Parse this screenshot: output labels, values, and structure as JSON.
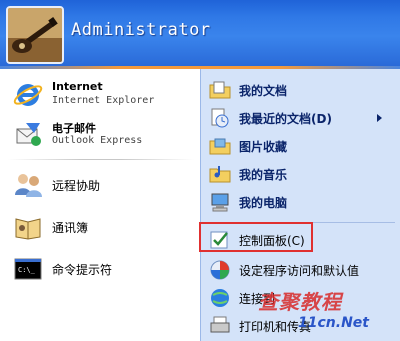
{
  "header": {
    "username": "Administrator"
  },
  "left": {
    "pinned": [
      {
        "title": "Internet",
        "subtitle": "Internet Explorer",
        "icon": "internet-explorer-icon"
      },
      {
        "title": "电子邮件",
        "subtitle": "Outlook Express",
        "icon": "outlook-express-icon"
      }
    ],
    "recent": [
      {
        "label": "远程协助",
        "icon": "remote-assistance-icon"
      },
      {
        "label": "通讯簿",
        "icon": "address-book-icon"
      },
      {
        "label": "命令提示符",
        "icon": "command-prompt-icon"
      }
    ]
  },
  "right": {
    "items": [
      {
        "label": "我的文档",
        "icon": "my-documents-icon"
      },
      {
        "label": "我最近的文档(D)",
        "icon": "recent-documents-icon",
        "submenu": true
      },
      {
        "label": "图片收藏",
        "icon": "my-pictures-icon"
      },
      {
        "label": "我的音乐",
        "icon": "my-music-icon"
      },
      {
        "label": "我的电脑",
        "icon": "my-computer-icon"
      }
    ],
    "system": [
      {
        "label": "控制面板(C)",
        "icon": "control-panel-icon",
        "highlighted": true
      },
      {
        "label": "设定程序访问和默认值",
        "icon": "program-access-icon"
      },
      {
        "label": "连接到",
        "icon": "connect-to-icon"
      },
      {
        "label": "打印机和传真",
        "icon": "printers-icon"
      }
    ]
  },
  "watermark": {
    "main": "查聚教程",
    "sub": "11cn.Net"
  },
  "colors": {
    "header_blue": "#2f78e6",
    "right_panel": "#d4e3f9",
    "highlight_red": "#e03030"
  }
}
